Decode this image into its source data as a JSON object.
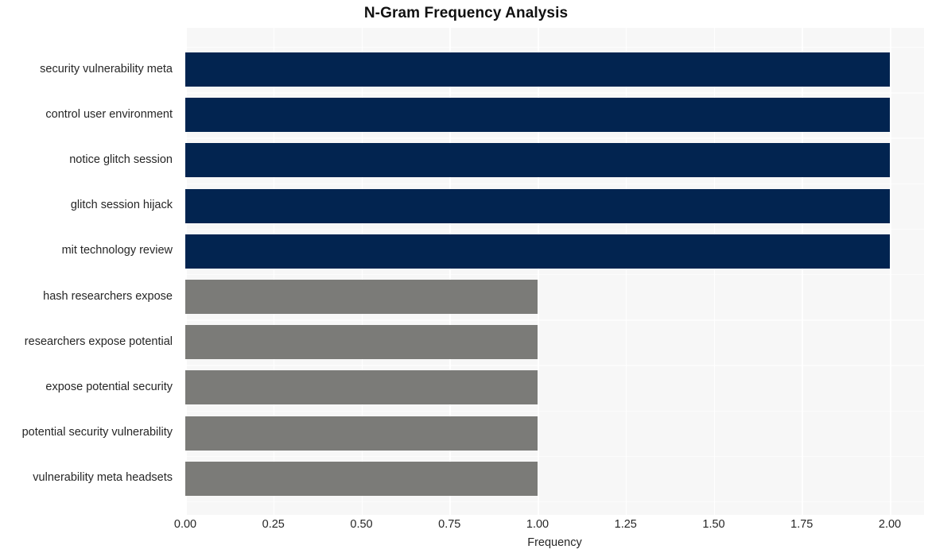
{
  "chart_data": {
    "type": "bar",
    "orientation": "horizontal",
    "title": "N-Gram Frequency Analysis",
    "xlabel": "Frequency",
    "ylabel": "",
    "categories": [
      "security vulnerability meta",
      "control user environment",
      "notice glitch session",
      "glitch session hijack",
      "mit technology review",
      "hash researchers expose",
      "researchers expose potential",
      "expose potential security",
      "potential security vulnerability",
      "vulnerability meta headsets"
    ],
    "values": [
      2,
      2,
      2,
      2,
      2,
      1,
      1,
      1,
      1,
      1
    ],
    "bar_colors": [
      "#022450",
      "#022450",
      "#022450",
      "#022450",
      "#022450",
      "#7b7b78",
      "#7b7b78",
      "#7b7b78",
      "#7b7b78",
      "#7b7b78"
    ],
    "xlim": [
      0,
      2
    ],
    "xticks": [
      0,
      0.25,
      0.5,
      0.75,
      1,
      1.25,
      1.5,
      1.75,
      2
    ],
    "xticklabels": [
      "0.00",
      "0.25",
      "0.50",
      "0.75",
      "1.00",
      "1.25",
      "1.50",
      "1.75",
      "2.00"
    ],
    "grid": true,
    "legend": null,
    "plot_background": "#f7f7f7",
    "grid_color": "#ffffff",
    "figure_background": "#ffffff"
  }
}
